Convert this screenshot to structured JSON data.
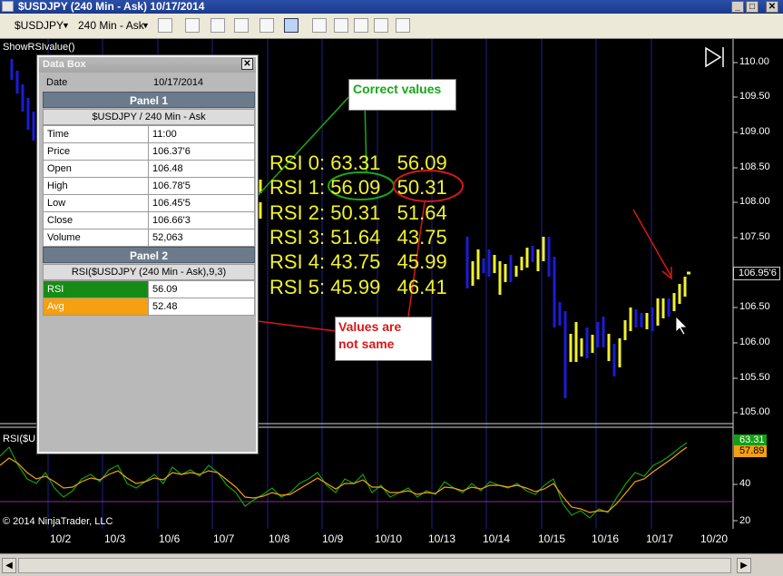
{
  "window": {
    "title": "$USDJPY (240 Min - Ask)   10/17/2014",
    "minimize": "_",
    "maximize": "□",
    "close": "✕"
  },
  "toolbar": {
    "instrument": "$USDJPY",
    "interval": "240 Min - Ask"
  },
  "indicator_label": "ShowRSIvalue()",
  "databox": {
    "title": "Data Box",
    "close": "✕",
    "date_label": "Date",
    "date_value": "10/17/2014",
    "panel1": "Panel 1",
    "panel1_sub": "$USDJPY / 240 Min - Ask",
    "rows1": [
      {
        "k": "Time",
        "v": "11:00"
      },
      {
        "k": "Price",
        "v": "106.37'6"
      },
      {
        "k": "Open",
        "v": "106.48"
      },
      {
        "k": "High",
        "v": "106.78'5"
      },
      {
        "k": "Low",
        "v": "106.45'5"
      },
      {
        "k": "Close",
        "v": "106.66'3"
      },
      {
        "k": "Volume",
        "v": "52,063"
      }
    ],
    "panel2": "Panel 2",
    "panel2_sub": "RSI($USDJPY (240 Min - Ask),9,3)",
    "rsi_label": "RSI",
    "rsi_value": "56.09",
    "avg_label": "Avg",
    "avg_value": "52.48"
  },
  "rsi_lines": [
    "RSI 0: 63.31   56.09",
    "RSI 1: 56.09   50.31",
    "RSI 2: 50.31   51.64",
    "RSI 3: 51.64   43.75",
    "RSI 4: 43.75   45.99",
    "RSI 5: 45.99   46.41"
  ],
  "annotations": {
    "correct": "Correct values",
    "not_same_1": "Values are",
    "not_same_2": "not same"
  },
  "price_axis": [
    "110.00",
    "109.50",
    "109.00",
    "108.50",
    "108.00",
    "107.50",
    "107.00",
    "106.50",
    "106.00",
    "105.50",
    "105.00"
  ],
  "price_current": "106.95'6",
  "rsi_axis": [
    "40",
    "20"
  ],
  "rsi_current": "63.31",
  "avg_current": "57.89",
  "rsi_panel_label": "RSI($U",
  "copyright": "© 2014 NinjaTrader, LLC",
  "x_axis": [
    "10/2",
    "10/3",
    "10/6",
    "10/7",
    "10/8",
    "10/9",
    "10/10",
    "10/13",
    "10/14",
    "10/15",
    "10/16",
    "10/17",
    "10/20"
  ],
  "colors": {
    "up_bar": "#f2f22a",
    "down_bar": "#1c1cd8",
    "rsi": "#12a012",
    "avg": "#f5a010",
    "annot_green": "#18a818",
    "annot_red": "#d81818"
  }
}
